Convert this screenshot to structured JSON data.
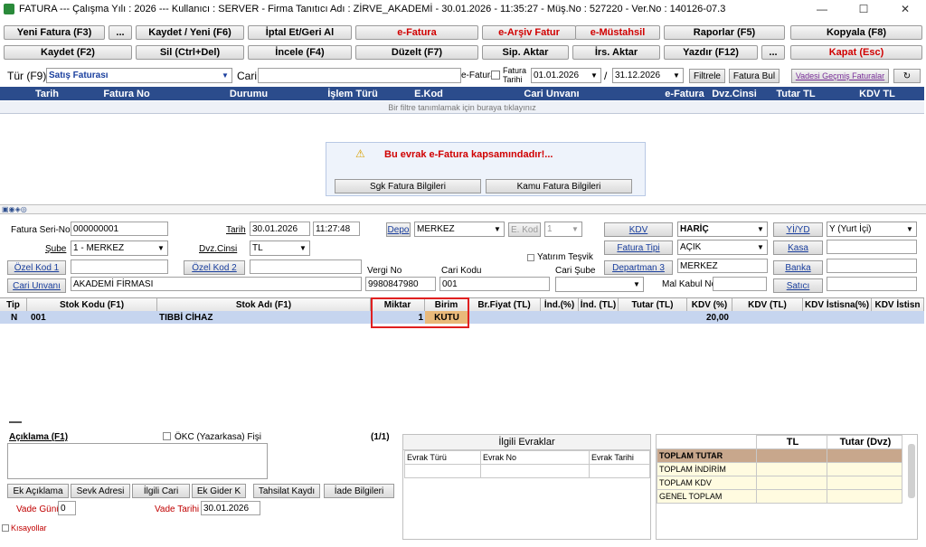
{
  "window": {
    "title": "FATURA  ---  Çalışma Yılı : 2026  ---  Kullanıcı : SERVER - Firma Tanıtıcı Adı : ZİRVE_AKADEMİ - 30.01.2026 - 11:35:27 - Müş.No : 527220 - Ver.No : 140126-07.3",
    "minimize": "—",
    "maximize": "☐",
    "close": "✕"
  },
  "toolbar1": {
    "yeni_fatura": "Yeni Fatura (F3)",
    "dots1": "...",
    "kaydet_yeni": "Kaydet / Yeni (F6)",
    "iptal": "İptal Et/Geri Al",
    "efatura": "e-Fatura",
    "earsiv": "e-Arşiv Fatur",
    "emustahsil": "e-Müstahsil",
    "raporlar": "Raporlar (F5)",
    "kopyala": "Kopyala (F8)"
  },
  "toolbar2": {
    "kaydet": "Kaydet (F2)",
    "sil": "Sil (Ctrl+Del)",
    "incele": "İncele (F4)",
    "duzelt": "Düzelt (F7)",
    "sip_aktar": "Sip. Aktar",
    "irs_aktar": "İrs. Aktar",
    "yazdir": "Yazdır (F12)",
    "dots2": "...",
    "kapat": "Kapat (Esc)"
  },
  "filter": {
    "tur_label": "Tür (F9)",
    "tur_value": "Satış Faturası",
    "cari_label": "Cari",
    "efatura_label": "e-Fatura",
    "fatura_tarihi_label": "Fatura Tarihi",
    "date_from": "01.01.2026",
    "slash": "/",
    "date_to": "31.12.2026",
    "filtrele": "Filtrele",
    "fatura_bul": "Fatura Bul",
    "vadesi": "Vadesi Geçmiş Faturalar",
    "refresh": "↻"
  },
  "grid": {
    "headers": [
      "Tarih",
      "Fatura No",
      "Durumu",
      "İşlem Türü",
      "E.Kod",
      "Cari Unvanı",
      "e-Fatura",
      "Dvz.Cinsi",
      "Tutar TL",
      "KDV TL"
    ],
    "filter_hint": "Bir filtre tanımlamak için buraya tıklayınız"
  },
  "notice": {
    "icon": "⚠",
    "message": "Bu evrak e-Fatura kapsamındadır!...",
    "sgk": "Sgk Fatura Bilgileri",
    "kamu": "Kamu Fatura Bilgileri"
  },
  "form": {
    "fatura_seri_label": "Fatura Seri-No",
    "fatura_seri": "000000001",
    "tarih_label": "Tarih",
    "tarih": "30.01.2026",
    "saat": "11:27:48",
    "depo_btn": "Depo",
    "depo": "MERKEZ",
    "ekod_btn": "E. Kod",
    "ekod": "1",
    "kdv_btn": "KDV",
    "kdv": "HARİÇ",
    "yiyd_btn": "Yİ/YD",
    "yiyd": "Y (Yurt İçi)",
    "sube_label": "Şube",
    "sube": "1 - MERKEZ",
    "dvz_label": "Dvz.Cinsi",
    "dvz": "TL",
    "yatirim": "Yatırım Teşvik",
    "fatura_tipi_btn": "Fatura Tipi",
    "fatura_tipi": "AÇIK",
    "kasa_btn": "Kasa",
    "ozel1": "Özel Kod 1",
    "ozel2": "Özel Kod 2",
    "departman_btn": "Departman 3",
    "departman": "MERKEZ",
    "banka_btn": "Banka",
    "vergi_label": "Vergi No",
    "cari_kodu_label": "Cari Kodu",
    "cari_sube_label": "Cari Şube",
    "cari_unvani_btn": "Cari Unvanı",
    "cari_unvani": "AKADEMİ FİRMASI",
    "vergi_no": "9980847980",
    "cari_kodu": "001",
    "mal_kabul_label": "Mal Kabul No",
    "satici_btn": "Satıcı"
  },
  "lines": {
    "headers": [
      "Tip",
      "Stok Kodu (F1)",
      "Stok Adı (F1)",
      "Miktar",
      "Birim",
      "Br.Fiyat (TL)",
      "İnd.(%)",
      "İnd. (TL)",
      "Tutar (TL)",
      "KDV (%)",
      "KDV (TL)",
      "KDV İstisna(%)",
      "KDV İstisn"
    ],
    "rows": [
      {
        "tip": "N",
        "stok_kodu": "001",
        "stok_adi": "TIBBİ CİHAZ",
        "miktar": "1",
        "birim": "KUTU",
        "kdv": "20,00"
      }
    ]
  },
  "bottom": {
    "aciklama": "Açıklama (F1)",
    "okc": "ÖKC (Yazarkasa) Fişi",
    "page": "(1/1)",
    "ek_aciklama": "Ek Açıklama",
    "sevk": "Sevk Adresi",
    "ilgili_cari": "İlgili Cari",
    "ek_gider": "Ek Gider K",
    "tahsilat": "Tahsilat Kaydı",
    "iade": "İade Bilgileri",
    "vade_gunu_label": "Vade Günü",
    "vade_gunu": "0",
    "vade_tarihi_label": "Vade Tarihi",
    "vade_tarihi": "30.01.2026",
    "kisayollar": "Kısayollar",
    "ilgili_evraklar": "İlgili Evraklar",
    "evrak_turu": "Evrak Türü",
    "evrak_no": "Evrak No",
    "evrak_tarihi": "Evrak Tarihi",
    "totals_tl": "TL",
    "totals_dvz": "Tutar (Dvz)",
    "totals": [
      "TOPLAM TUTAR",
      "TOPLAM İNDİRİM",
      "TOPLAM KDV",
      "GENEL TOPLAM"
    ]
  },
  "colors": {
    "grid_header": "#2b4c8c",
    "highlight": "#e02020",
    "selected_row": "#c6d5ef",
    "total_header": "#c8a78c",
    "total_rows": "#fffbe0"
  }
}
